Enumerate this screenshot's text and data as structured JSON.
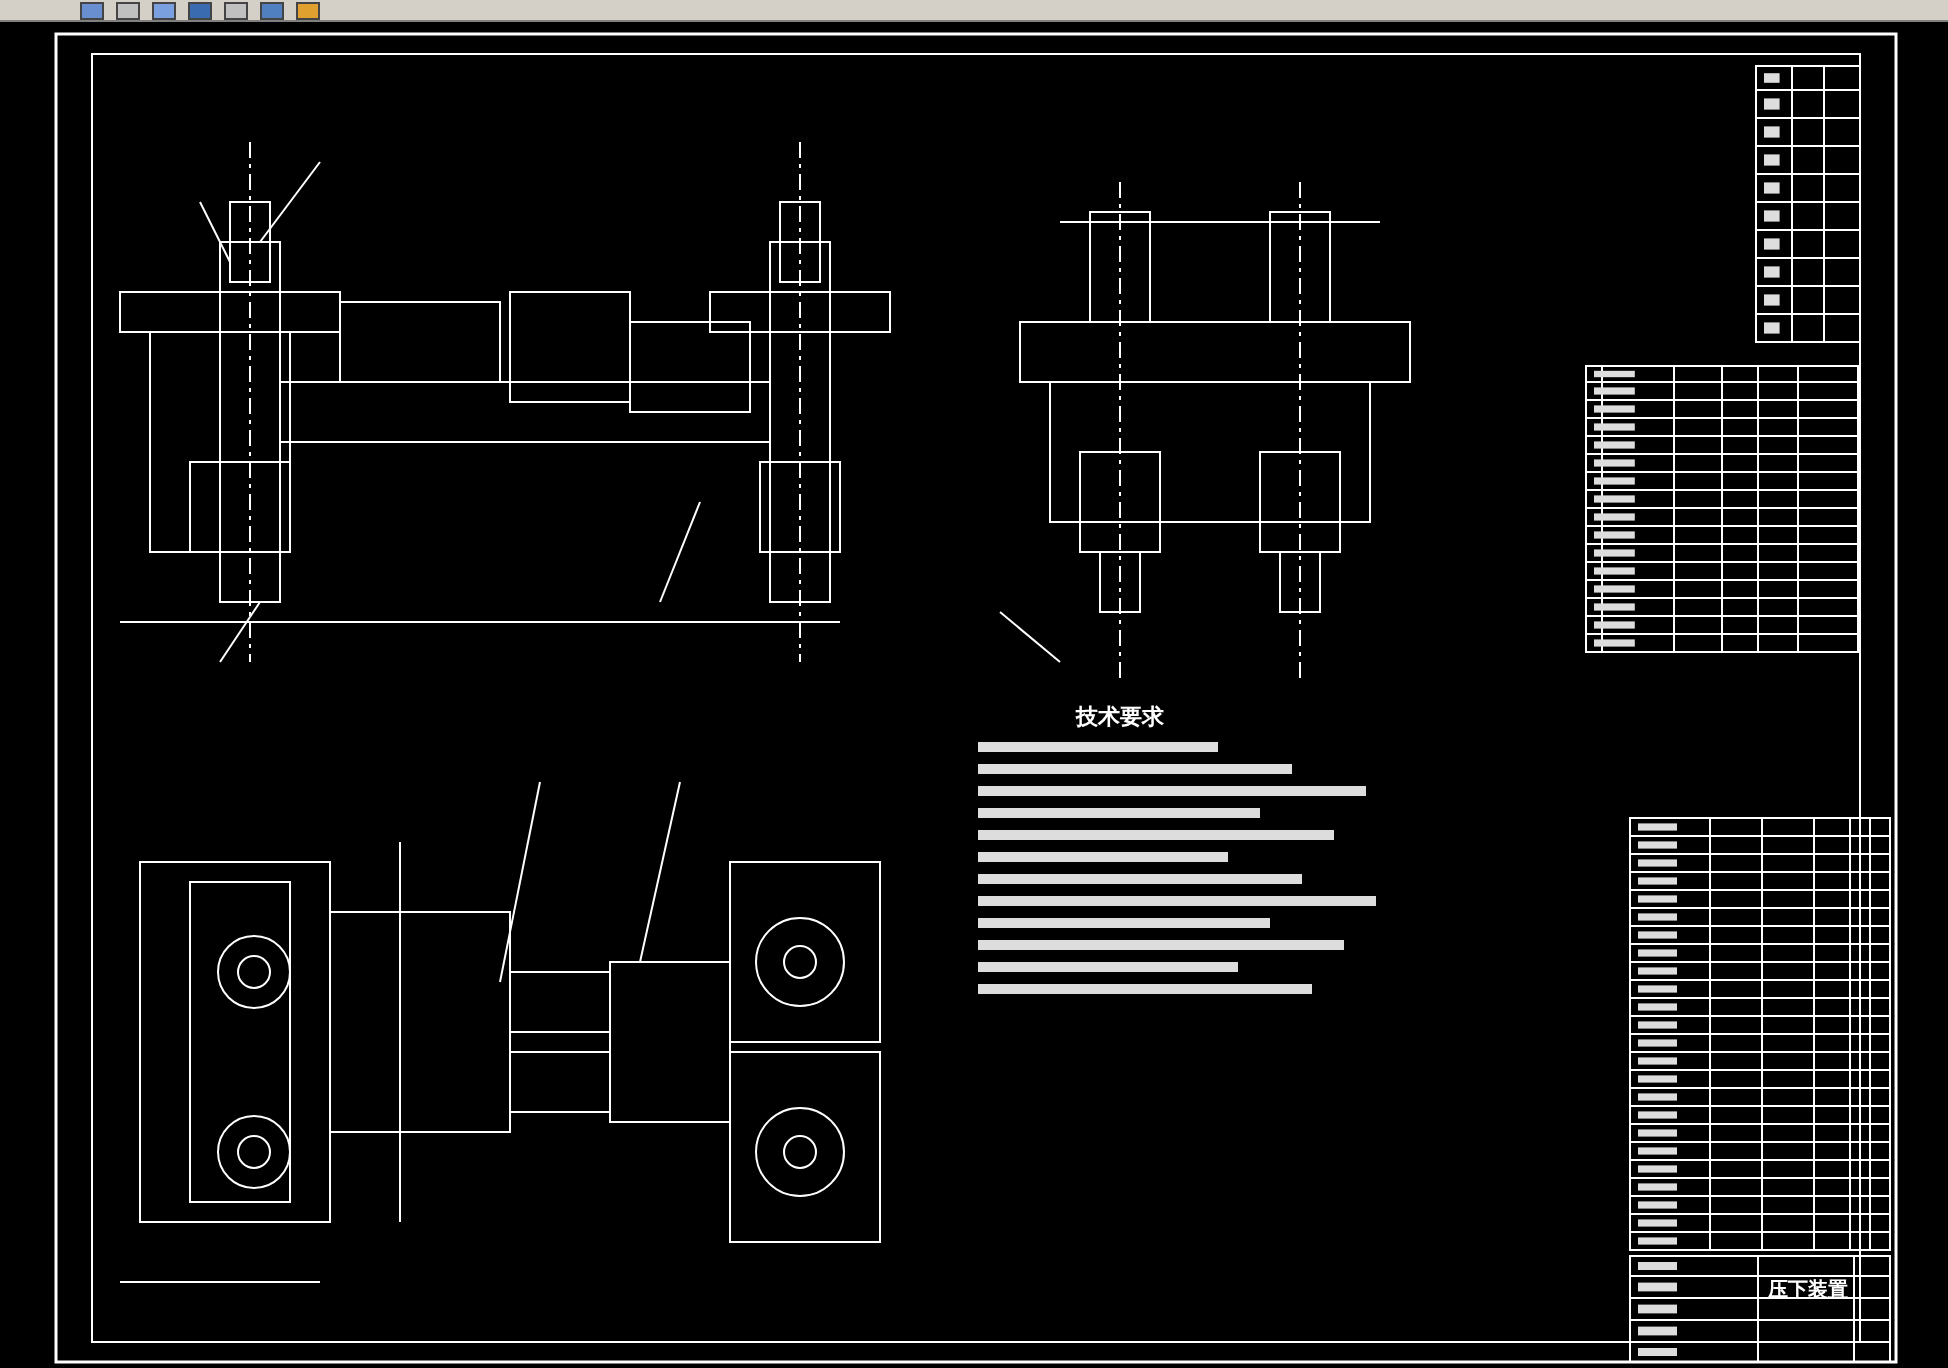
{
  "technical_requirements": {
    "heading": "技术要求"
  },
  "title_block": {
    "drawing_name": "压下装置"
  }
}
